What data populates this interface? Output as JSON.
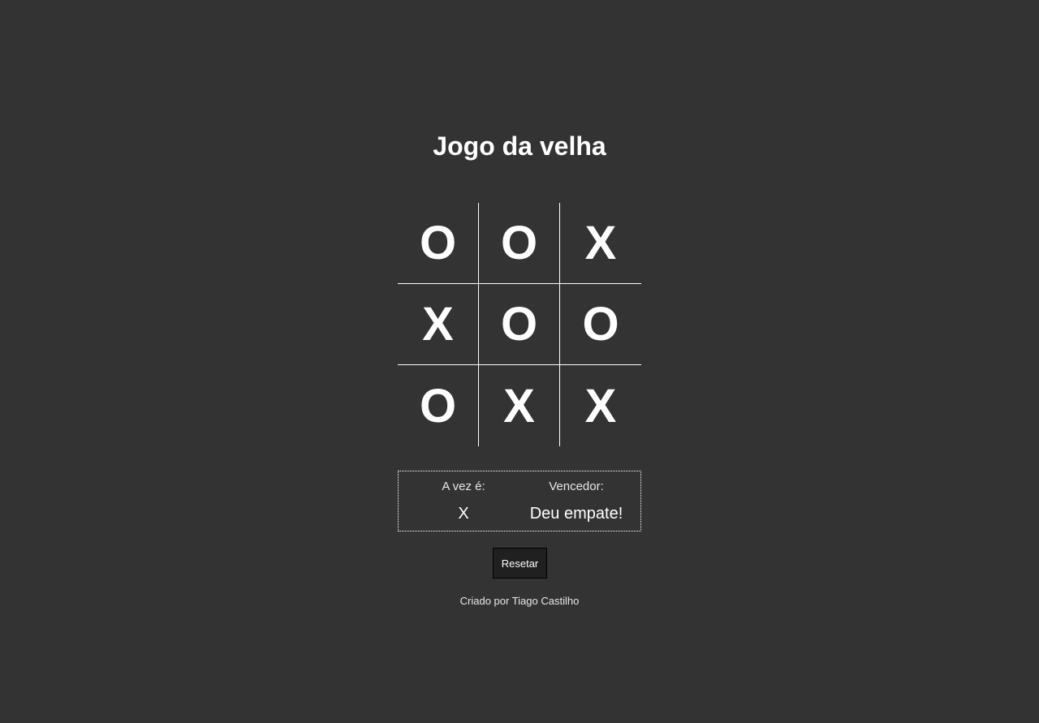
{
  "title": "Jogo da velha",
  "board": {
    "cells": [
      [
        "O",
        "O",
        "X"
      ],
      [
        "X",
        "O",
        "O"
      ],
      [
        "O",
        "X",
        "X"
      ]
    ]
  },
  "status": {
    "turn_label": "A vez é:",
    "turn_value": "X",
    "winner_label": "Vencedor:",
    "winner_value": "Deu empate!"
  },
  "reset_label": "Resetar",
  "credit": "Criado por Tiago Castilho",
  "colors": {
    "background": "#333333",
    "foreground": "#ffffff",
    "button_background": "#202020"
  }
}
